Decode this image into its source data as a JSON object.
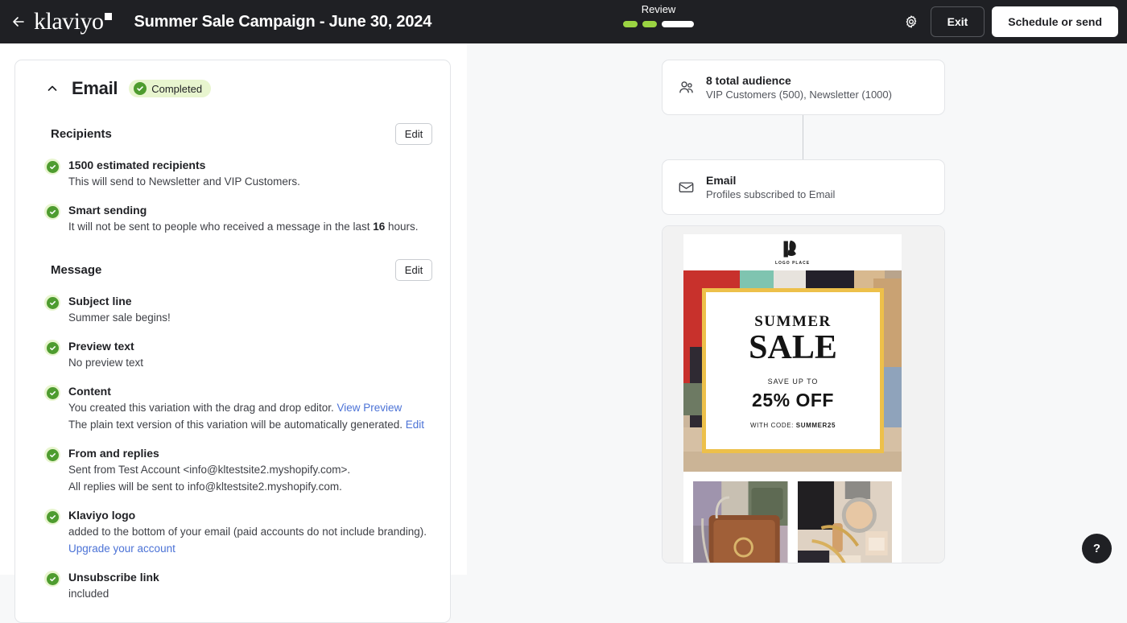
{
  "topbar": {
    "back_icon": "arrow-left-icon",
    "brand": "klaviyo",
    "campaign_title": "Summer Sale Campaign - June 30, 2024",
    "progress_label": "Review",
    "progress_steps": [
      "done",
      "done",
      "current"
    ],
    "gear_icon": "gear-icon",
    "exit_label": "Exit",
    "schedule_label": "Schedule or send",
    "bg_color": "#1f2024",
    "accent_green": "#9bd442"
  },
  "email_section": {
    "collapse_icon": "chevron-up-icon",
    "title": "Email",
    "status_badge": "Completed",
    "badge_bg": "#e8f5cf",
    "check_color": "#4e9c2f"
  },
  "recipients": {
    "heading": "Recipients",
    "edit_label": "Edit",
    "items": [
      {
        "title": "1500 estimated recipients",
        "sub": "This will send to Newsletter and VIP Customers."
      },
      {
        "title": "Smart sending",
        "sub_pre": "It will not be sent to people who received a message in the last ",
        "sub_bold": "16",
        "sub_post": " hours."
      }
    ]
  },
  "message": {
    "heading": "Message",
    "edit_label": "Edit",
    "items": [
      {
        "title": "Subject line",
        "sub": "Summer sale begins!"
      },
      {
        "title": "Preview text",
        "sub": "No preview text"
      },
      {
        "title": "Content",
        "line1_pre": "You created this variation with the drag and drop editor. ",
        "line1_link": "View Preview",
        "line2_pre": "The plain text version of this variation will be automatically generated. ",
        "line2_link": "Edit"
      },
      {
        "title": "From and replies",
        "line1": "Sent from Test Account <info@kltestsite2.myshopify.com>.",
        "line2": "All replies will be sent to info@kltestsite2.myshopify.com."
      },
      {
        "title": "Klaviyo logo",
        "line1": "added to the bottom of your email (paid accounts do not include branding).",
        "line2_link": "Upgrade your account"
      },
      {
        "title": "Unsubscribe link",
        "sub": "included"
      }
    ]
  },
  "audience_card": {
    "icon": "people-icon",
    "title": "8 total audience",
    "sub": "VIP Customers (500), Newsletter (1000)"
  },
  "channel_card": {
    "icon": "envelope-icon",
    "title": "Email",
    "sub": "Profiles subscribed to Email"
  },
  "preview": {
    "logo_text": "LOGO PLACE",
    "headline_top": "SUMMER",
    "headline_main": "SALE",
    "save_up_to": "SAVE UP TO",
    "discount": "25% OFF",
    "code_label": "WITH CODE: ",
    "code_value": "SUMMER25",
    "frame_color": "#edc04a"
  },
  "help": {
    "label": "?"
  }
}
